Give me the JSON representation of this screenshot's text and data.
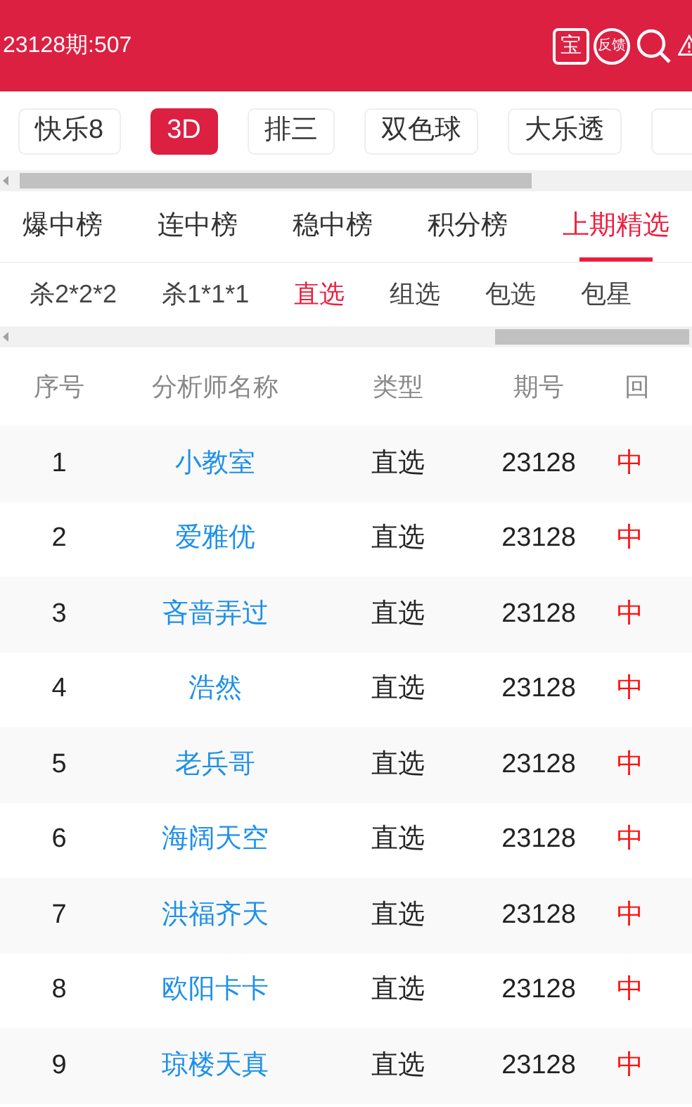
{
  "header": {
    "title": "23128期:507",
    "icons": [
      {
        "kind": "box",
        "label": "宝"
      },
      {
        "kind": "circle",
        "label": "反馈"
      },
      {
        "kind": "search"
      },
      {
        "kind": "warning"
      }
    ]
  },
  "lottery_tabs": [
    {
      "label": "快乐8",
      "selected": false
    },
    {
      "label": "3D",
      "selected": true
    },
    {
      "label": "排三",
      "selected": false
    },
    {
      "label": "双色球",
      "selected": false
    },
    {
      "label": "大乐透",
      "selected": false
    }
  ],
  "rank_tabs": [
    {
      "label": "爆中榜",
      "selected": false
    },
    {
      "label": "连中榜",
      "selected": false
    },
    {
      "label": "稳中榜",
      "selected": false
    },
    {
      "label": "积分榜",
      "selected": false
    },
    {
      "label": "上期精选",
      "selected": true
    }
  ],
  "play_tabs": [
    {
      "label": "杀2*2*2",
      "selected": false
    },
    {
      "label": "杀1*1*1",
      "selected": false
    },
    {
      "label": "直选",
      "selected": true
    },
    {
      "label": "组选",
      "selected": false
    },
    {
      "label": "包选",
      "selected": false
    },
    {
      "label": "包星",
      "selected": false
    }
  ],
  "table": {
    "columns": [
      "序号",
      "分析师名称",
      "类型",
      "期号",
      "回"
    ],
    "rows": [
      [
        "1",
        "小教室",
        "直选",
        "23128",
        "中"
      ],
      [
        "2",
        "爱雅优",
        "直选",
        "23128",
        "中"
      ],
      [
        "3",
        "吝啬弄过",
        "直选",
        "23128",
        "中"
      ],
      [
        "4",
        "浩然",
        "直选",
        "23128",
        "中"
      ],
      [
        "5",
        "老兵哥",
        "直选",
        "23128",
        "中"
      ],
      [
        "6",
        "海阔天空",
        "直选",
        "23128",
        "中"
      ],
      [
        "7",
        "洪福齐天",
        "直选",
        "23128",
        "中"
      ],
      [
        "8",
        "欧阳卡卡",
        "直选",
        "23128",
        "中"
      ],
      [
        "9",
        "琼楼天真",
        "直选",
        "23128",
        "中"
      ]
    ]
  }
}
